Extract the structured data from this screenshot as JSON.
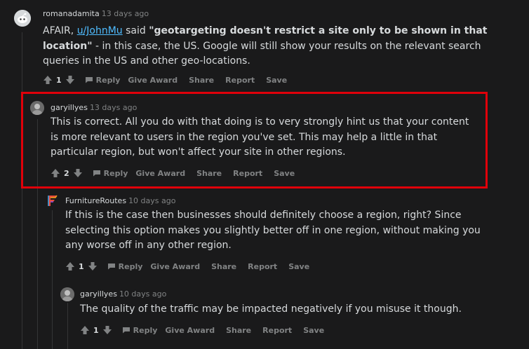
{
  "comments": [
    {
      "user": "romanadamita",
      "time": "13 days ago",
      "text_prefix": "AFAIR, ",
      "link": "u/JohnMu",
      "text_mid": " said ",
      "text_bold": "\"geotargeting doesn't restrict a site only to be shown in that location\"",
      "text_suffix": " - in this case, the US. Google will still show your results on the relevant search queries in the US and other geo-locations.",
      "score": "1",
      "actions": [
        "Reply",
        "Give Award",
        "Share",
        "Report",
        "Save"
      ]
    },
    {
      "user": "garyillyes",
      "time": "13 days ago",
      "text": "This is correct. All you do with that doing is to very strongly hint us that your content is more relevant to users in the region you've set. This may help a little in that particular region, but won't affect your site in other regions.",
      "score": "2",
      "actions": [
        "Reply",
        "Give Award",
        "Share",
        "Report",
        "Save"
      ]
    },
    {
      "user": "FurnitureRoutes",
      "time": "10 days ago",
      "text": "If this is the case then businesses should definitely choose a region, right? Since selecting this option makes you slightly better off in one region, without making you any worse off in any other region.",
      "score": "1",
      "actions": [
        "Reply",
        "Give Award",
        "Share",
        "Report",
        "Save"
      ]
    },
    {
      "user": "garyillyes",
      "time": "10 days ago",
      "text": "The quality of the traffic may be impacted negatively if you misuse it though.",
      "score": "1",
      "actions": [
        "Reply",
        "Give Award",
        "Share",
        "Report",
        "Save"
      ]
    }
  ],
  "colors": {
    "background": "#1a1a1b",
    "text": "#d7dadc",
    "muted": "#818384",
    "link": "#4fbcff",
    "highlight": "#e0000a"
  }
}
